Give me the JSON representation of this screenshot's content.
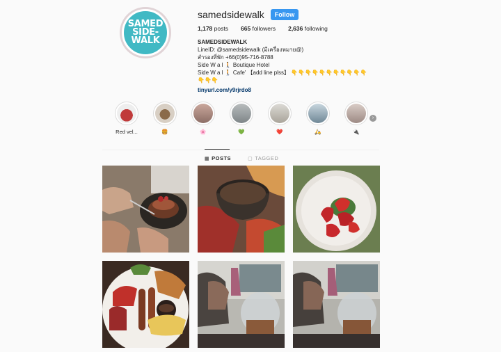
{
  "profile": {
    "username": "samedsidewalk",
    "follow_label": "Follow",
    "logo_lines": [
      "SAMED",
      "SIDE-",
      "WALK"
    ],
    "stats": {
      "posts_value": "1,178",
      "posts_label": "posts",
      "followers_value": "665",
      "followers_label": "followers",
      "following_value": "2,636",
      "following_label": "following"
    },
    "bio": {
      "name": "SAMEDSIDEWALK",
      "line1": "LineID: @samedsidewalk (มีเครื่องหมาย@)",
      "line2": "สำรองที่พัก +66(0)95-716-8788",
      "line3_prefix": "Side W a l ",
      "line3_suffix": " Boutique Hotel",
      "line4_prefix": "Side W a l ",
      "line4_suffix": " Cafe' 【add line plss】",
      "link": "tinyurl.com/y9rjrdo8"
    }
  },
  "highlights": [
    {
      "label": "Red vel...",
      "color": "#c44a4a"
    },
    {
      "label": "🍔",
      "color": "#8a6a4a"
    },
    {
      "label": "🌸",
      "color": "#b98c7e"
    },
    {
      "label": "💚",
      "color": "#9aa0a3"
    },
    {
      "label": "❤️",
      "color": "#c9c6bf"
    },
    {
      "label": "🛵",
      "color": "#9eb3c0"
    },
    {
      "label": "🔌",
      "color": "#b8a9a3"
    }
  ],
  "tabs": {
    "posts": "POSTS",
    "tagged": "TAGGED"
  },
  "posts": [
    {
      "name": "pancakes-photo"
    },
    {
      "name": "coffee-bowl-photo"
    },
    {
      "name": "strawberries-photo"
    },
    {
      "name": "breakfast-plate-photo"
    },
    {
      "name": "cafe-counter-photo-1"
    },
    {
      "name": "cafe-counter-photo-2"
    }
  ]
}
